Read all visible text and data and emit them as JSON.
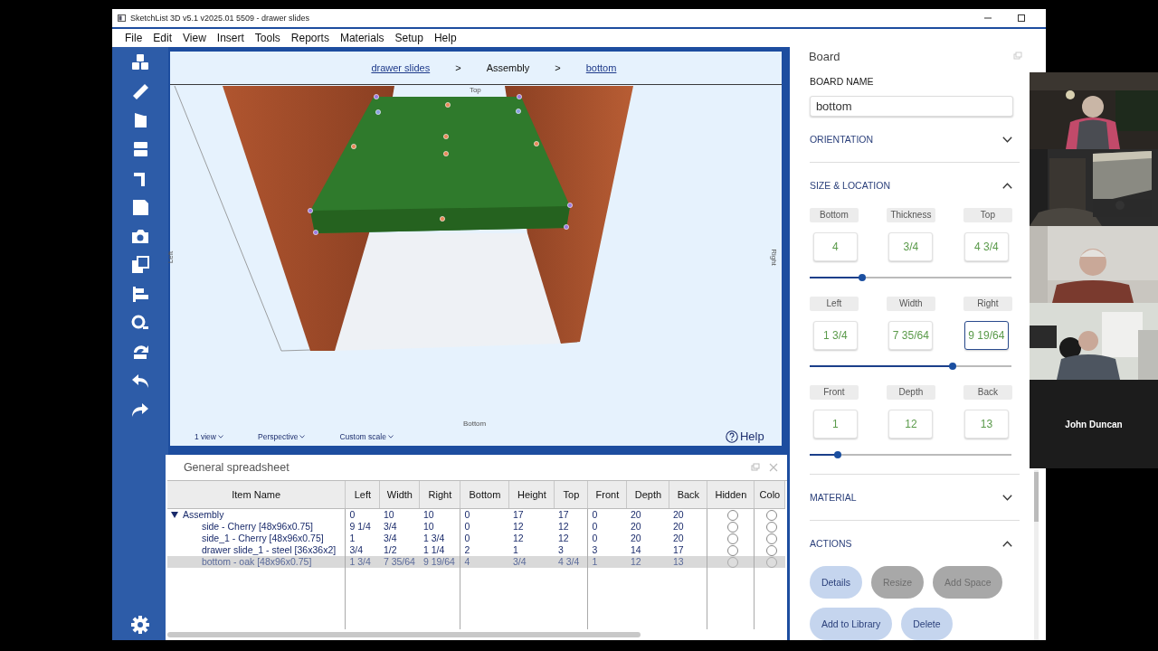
{
  "window": {
    "title": "SketchList 3D v5.1 v2025.01 5509 - drawer slides"
  },
  "menu": [
    "File",
    "Edit",
    "View",
    "Insert",
    "Tools",
    "Reports",
    "Materials",
    "Setup",
    "Help"
  ],
  "viewport": {
    "breadcrumbs": [
      {
        "kind": "link",
        "label": "drawer slides"
      },
      {
        "kind": "separator",
        "label": ">"
      },
      {
        "kind": "current",
        "label": "Assembly"
      },
      {
        "kind": "separator",
        "label": ">"
      },
      {
        "kind": "link",
        "label": "bottom"
      }
    ],
    "axis_labels": {
      "top": "Top",
      "left": "Left",
      "right": "Right",
      "bottom": "Bottom"
    },
    "options": [
      "1 view",
      "Perspective",
      "Custom scale"
    ],
    "help": "Help"
  },
  "spreadsheet": {
    "title": "General spreadsheet",
    "name_column": "Item Name",
    "value_columns": [
      "Left",
      "Width",
      "Right",
      "Bottom",
      "Height",
      "Top",
      "Front",
      "Depth",
      "Back"
    ],
    "flag_columns": [
      "Hidden",
      "Colo"
    ],
    "rows": [
      {
        "name": "Assembly",
        "expanded": true,
        "selected": false,
        "cells": [
          "0",
          "10",
          "10",
          "0",
          "17",
          "17",
          "0",
          "20",
          "20"
        ],
        "children": [
          {
            "name": "side - Cherry [48x96x0.75]",
            "selected": false,
            "cells": [
              "9 1/4",
              "3/4",
              "10",
              "0",
              "12",
              "12",
              "0",
              "20",
              "20"
            ]
          },
          {
            "name": "side_1 - Cherry [48x96x0.75]",
            "selected": false,
            "cells": [
              "1",
              "3/4",
              "1 3/4",
              "0",
              "12",
              "12",
              "0",
              "20",
              "20"
            ]
          },
          {
            "name": "drawer slide_1 - steel [36x36x2]",
            "selected": false,
            "cells": [
              "3/4",
              "1/2",
              "1 1/4",
              "2",
              "1",
              "3",
              "3",
              "14",
              "17"
            ]
          },
          {
            "name": "bottom - oak [48x96x0.75]",
            "selected": true,
            "cells": [
              "1 3/4",
              "7 35/64",
              "9 19/64",
              "4",
              "3/4",
              "4 3/4",
              "1",
              "12",
              "13"
            ]
          }
        ]
      }
    ]
  },
  "board": {
    "title": "Board",
    "name_label": "BOARD NAME",
    "name_value": "bottom",
    "sections": [
      {
        "title": "ORIENTATION",
        "expanded": false
      },
      {
        "title": "SIZE & LOCATION",
        "expanded": true,
        "groups": [
          {
            "fields": [
              {
                "label": "Bottom",
                "value": "4",
                "focused": false
              },
              {
                "label": "Thickness",
                "value": "3/4",
                "focused": false
              },
              {
                "label": "Top",
                "value": "4 3/4",
                "focused": false
              }
            ],
            "slider": {
              "level": 0.26
            }
          },
          {
            "fields": [
              {
                "label": "Left",
                "value": "1 3/4",
                "focused": false
              },
              {
                "label": "Width",
                "value": "7 35/64",
                "focused": false
              },
              {
                "label": "Right",
                "value": "9 19/64",
                "focused": true
              }
            ],
            "slider": {
              "level": 0.71
            }
          },
          {
            "fields": [
              {
                "label": "Front",
                "value": "1",
                "focused": false
              },
              {
                "label": "Depth",
                "value": "12",
                "focused": false
              },
              {
                "label": "Back",
                "value": "13",
                "focused": false
              }
            ],
            "slider": {
              "level": 0.14
            }
          }
        ]
      },
      {
        "title": "MATERIAL",
        "expanded": false
      },
      {
        "title": "ACTIONS",
        "expanded": true,
        "buttons": [
          {
            "label": "Details",
            "disabled": false
          },
          {
            "label": "Resize",
            "disabled": true
          },
          {
            "label": "Add Space",
            "disabled": true
          },
          {
            "label": "Add to Library",
            "disabled": false
          },
          {
            "label": "Delete",
            "disabled": false
          }
        ]
      }
    ]
  },
  "participants": [
    {
      "kind": "picture"
    },
    {
      "kind": "picture"
    },
    {
      "kind": "picture"
    },
    {
      "kind": "picture"
    },
    {
      "kind": "name",
      "name": "John Duncan"
    }
  ]
}
